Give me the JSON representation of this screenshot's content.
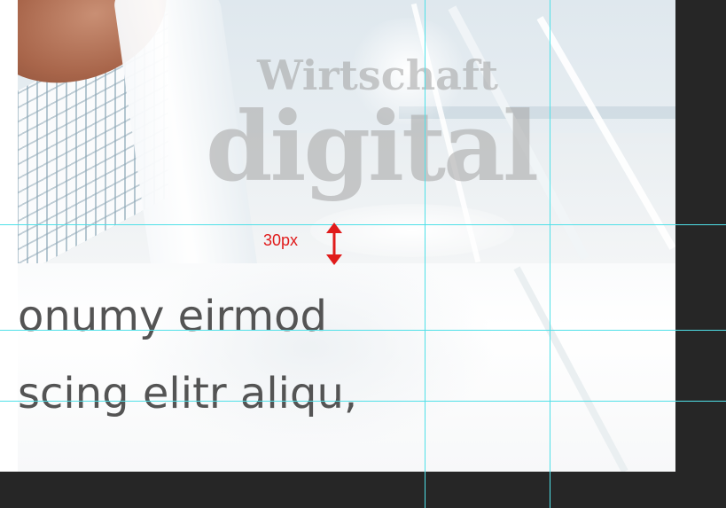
{
  "canvas": {
    "logo": {
      "line1": "Wirtschaft",
      "line2": "digital"
    },
    "body_text": {
      "line1": "onumy eirmod",
      "line2": "scing elitr aliqu,"
    }
  },
  "annotation": {
    "spacing_label": "30px",
    "color": "#e01b1b"
  },
  "guides": {
    "color": "#4fe0e8"
  },
  "pasteboard": {
    "color": "#262626"
  }
}
